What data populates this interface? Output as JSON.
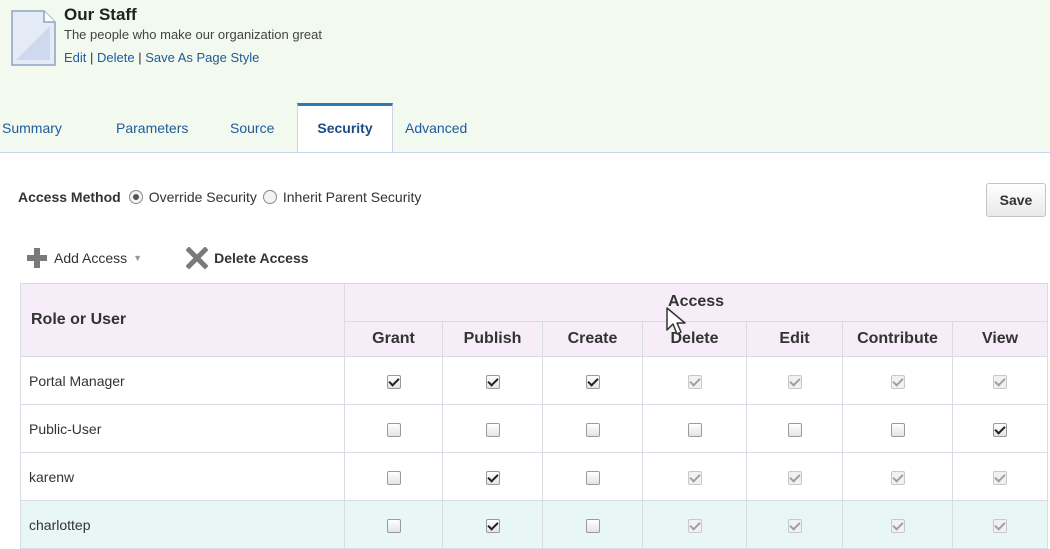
{
  "header": {
    "title": "Our Staff",
    "subtitle": "The people who make our organization great",
    "actions": [
      "Edit",
      "Delete",
      "Save As Page Style"
    ],
    "separator": " | ",
    "icon": "page-icon"
  },
  "tabs": [
    {
      "label": "Summary",
      "active": false
    },
    {
      "label": "Parameters",
      "active": false
    },
    {
      "label": "Source",
      "active": false
    },
    {
      "label": "Security",
      "active": true
    },
    {
      "label": "Advanced",
      "active": false
    }
  ],
  "access_method": {
    "label": "Access Method",
    "options": [
      {
        "label": "Override Security",
        "selected": true
      },
      {
        "label": "Inherit Parent Security",
        "selected": false
      }
    ]
  },
  "save_label": "Save",
  "toolbar": {
    "add_label": "Add Access",
    "add_icon": "plus-icon",
    "dropdown_icon": "chevron-down-icon",
    "delete_label": "Delete Access",
    "delete_icon": "x-icon"
  },
  "table": {
    "role_header": "Role or User",
    "access_header": "Access",
    "columns": [
      "Grant",
      "Publish",
      "Create",
      "Delete",
      "Edit",
      "Contribute",
      "View"
    ],
    "rows": [
      {
        "name": "Portal Manager",
        "checked": [
          true,
          true,
          true,
          true,
          true,
          true,
          true
        ],
        "disabled": [
          false,
          false,
          false,
          true,
          true,
          true,
          true
        ],
        "highlight": false
      },
      {
        "name": "Public-User",
        "checked": [
          false,
          false,
          false,
          false,
          false,
          false,
          true
        ],
        "disabled": [
          false,
          false,
          false,
          false,
          false,
          false,
          false
        ],
        "highlight": false
      },
      {
        "name": "karenw",
        "checked": [
          false,
          true,
          false,
          true,
          true,
          true,
          true
        ],
        "disabled": [
          false,
          false,
          false,
          true,
          true,
          true,
          true
        ],
        "highlight": false
      },
      {
        "name": "charlottep",
        "checked": [
          false,
          true,
          false,
          true,
          true,
          true,
          true
        ],
        "disabled": [
          false,
          false,
          false,
          true,
          true,
          true,
          true
        ],
        "highlight": true
      }
    ]
  },
  "colors": {
    "header_bg": "#f2f9ee",
    "link": "#1f5a9a",
    "tab_active_border": "#2f77b7",
    "table_header_bg": "#f6edf8",
    "row_highlight": "#e8f6f6"
  }
}
